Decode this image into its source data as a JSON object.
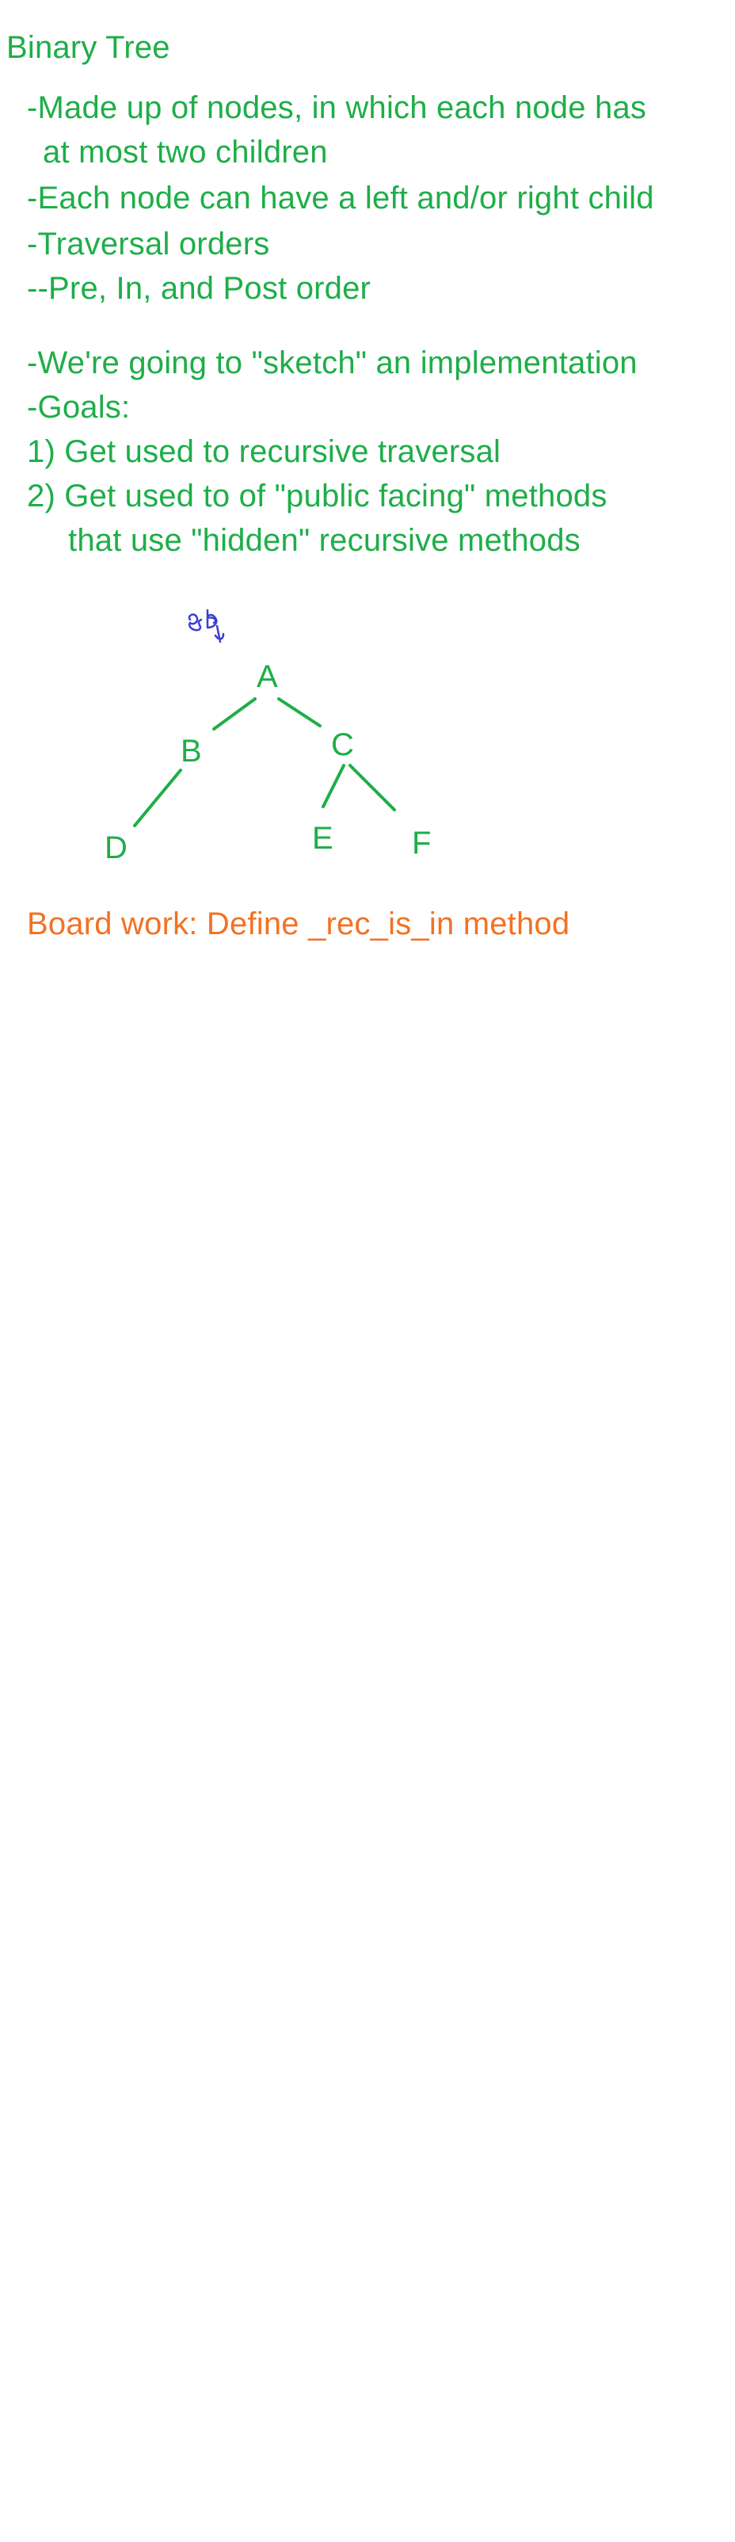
{
  "notes": {
    "title": "Binary Tree",
    "lines": [
      "-Made up of nodes, in which each node has",
      "at most two children",
      "-Each node can have a left and/or right child",
      "-Traversal orders",
      "--Pre, In, and Post order",
      "-We're going to \"sketch\" an implementation",
      "-Goals:"
    ],
    "goals": [
      "1) Get used to recursive traversal",
      "2) Get used to of \"public facing\" methods",
      "that use \"hidden\" recursive methods"
    ]
  },
  "tree": {
    "nodes": {
      "root": "A",
      "left": "B",
      "right": "C",
      "left_left": "D",
      "right_left": "E",
      "right_right": "F"
    }
  },
  "board_work": "Board work: Define _rec_is_in method",
  "colors": {
    "ink_green": "#1eae48",
    "ink_orange": "#f27224",
    "ink_blue": "#3a3fd6"
  }
}
